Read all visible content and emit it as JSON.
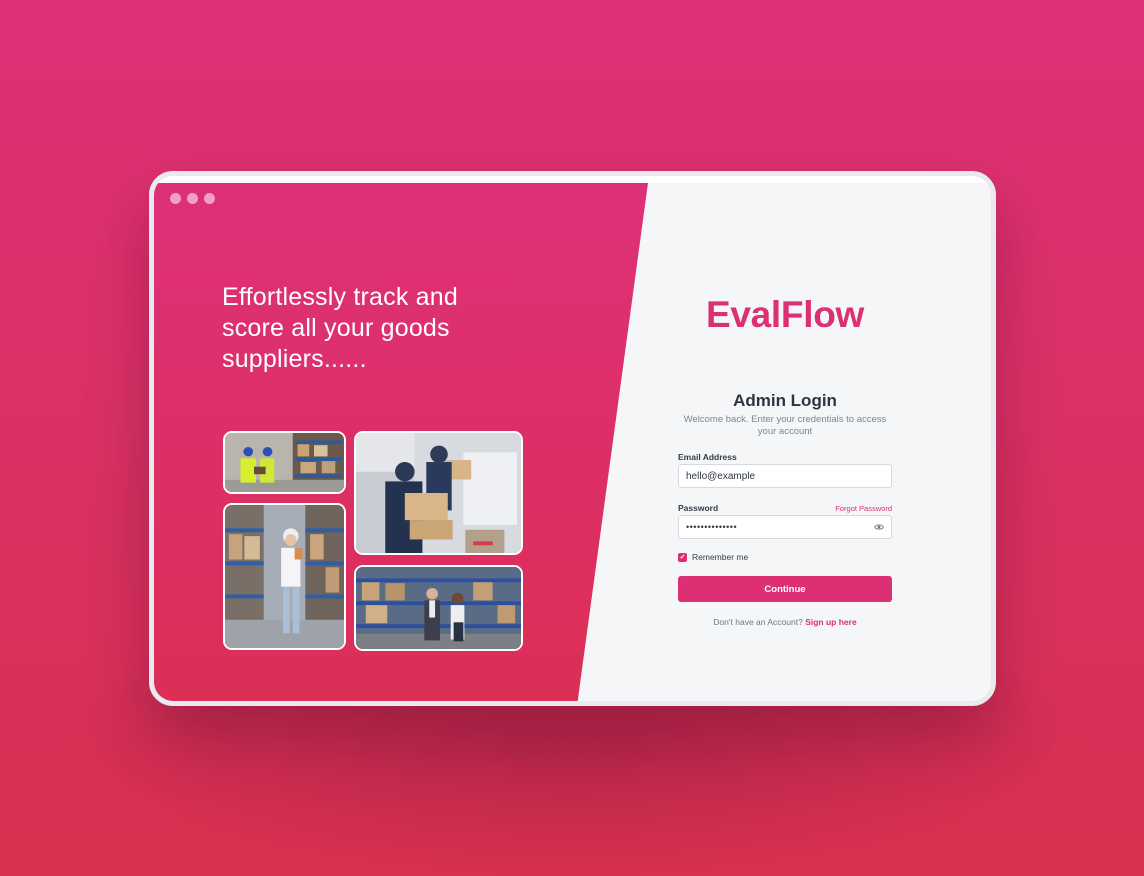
{
  "hero": {
    "tagline": "Effortlessly track and score all your goods suppliers......"
  },
  "brand": {
    "name": "EvalFlow"
  },
  "login": {
    "title": "Admin Login",
    "subtitle": "Welcome back. Enter your credentials to access your account",
    "email_label": "Email Address",
    "email_value": "hello@example",
    "password_label": "Password",
    "forgot_label": "Forgot Password",
    "password_mask": "••••••••••••••",
    "remember_label": "Remember me",
    "remember_checked": true,
    "continue_label": "Continue",
    "signup_prompt": "Don't have an Account?",
    "signup_link": "Sign up here"
  },
  "colors": {
    "accent": "#dc2f74",
    "background": "#de3078",
    "panel": "#f5f6f8"
  },
  "icons": [
    "window-dot-icon",
    "eye-icon",
    "checkmark-icon"
  ],
  "photos": [
    {
      "subject": "warehouse-workers-in-hardhats"
    },
    {
      "subject": "delivery-man-unloading-boxes"
    },
    {
      "subject": "woman-with-tablet-in-warehouse"
    },
    {
      "subject": "business-people-in-warehouse"
    }
  ]
}
